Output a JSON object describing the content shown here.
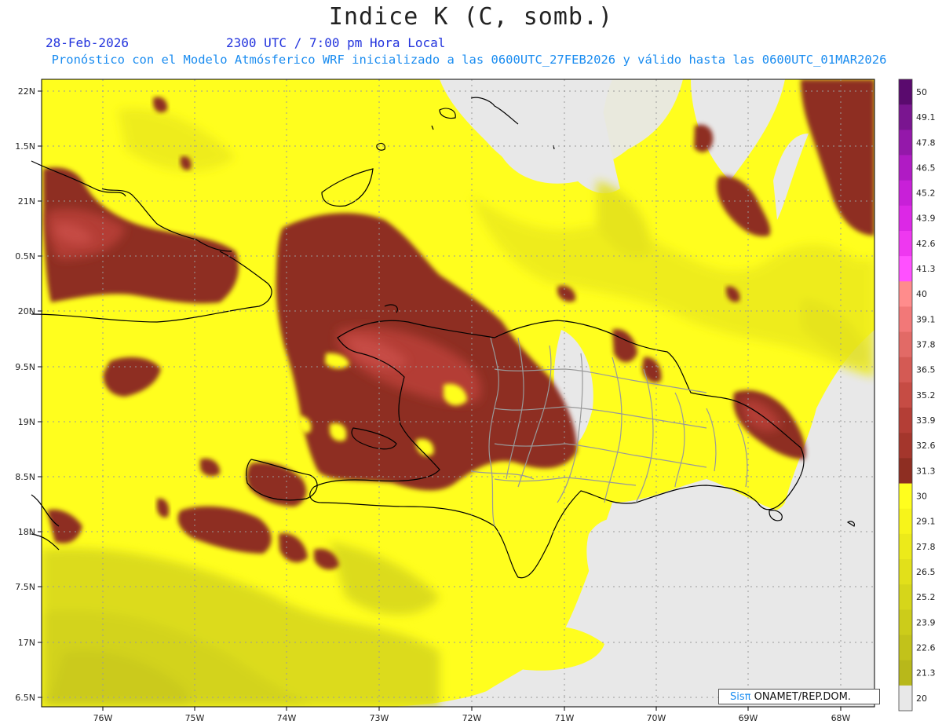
{
  "header": {
    "title": "Indice K (C, somb.)",
    "date": "28-Feb-2026",
    "time": "2300 UTC / 7:00 pm Hora Local",
    "info": "Pronóstico con el Modelo Atmósferico WRF inicializado a las 0600UTC_27FEB2026 y válido hasta las  0600UTC_01MAR2026"
  },
  "map": {
    "lat_labels": [
      "22N",
      "1.5N",
      "21N",
      "0.5N",
      "20N",
      "9.5N",
      "19N",
      "8.5N",
      "18N",
      "7.5N",
      "17N",
      "6.5N"
    ],
    "lon_labels": [
      "76W",
      "75W",
      "74W",
      "73W",
      "72W",
      "71W",
      "70W",
      "69W",
      "68W"
    ]
  },
  "colorbar": {
    "levels": [
      "50",
      "49.1",
      "47.8",
      "46.5",
      "45.2",
      "43.9",
      "42.6",
      "41.3",
      "40",
      "39.1",
      "37.8",
      "36.5",
      "35.2",
      "33.9",
      "32.6",
      "31.3",
      "30",
      "29.1",
      "27.8",
      "26.5",
      "25.2",
      "23.9",
      "22.6",
      "21.3",
      "20"
    ],
    "colors": [
      "#5a0a6e",
      "#7a1590",
      "#9418aa",
      "#b01bc4",
      "#c820d8",
      "#dc28e6",
      "#ee38f0",
      "#ff50ff",
      "#ff8c8c",
      "#f27878",
      "#e26a66",
      "#d45a54",
      "#c64c44",
      "#b43e36",
      "#a4362c",
      "#8e2e22",
      "#fffe1e",
      "#f7f41a",
      "#ecea1a",
      "#e2e01a",
      "#d6d61a",
      "#cccc1a",
      "#c2c21a",
      "#b8b81a",
      "#e8e8e8"
    ]
  },
  "credit": {
    "logo": "Sisπ",
    "text": " ONAMET/REP.DOM."
  }
}
